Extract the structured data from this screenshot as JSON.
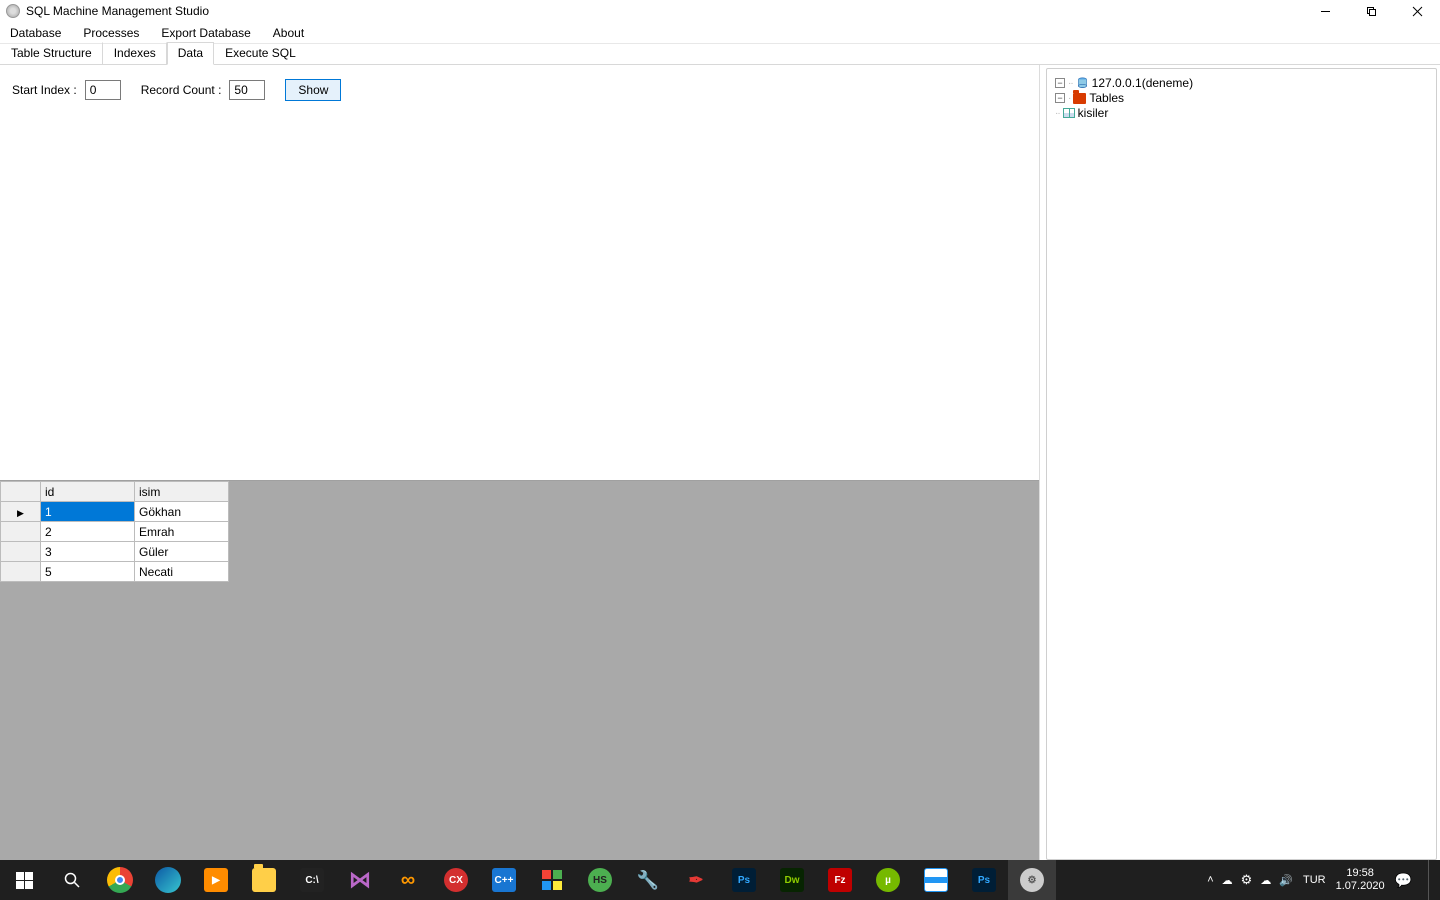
{
  "window": {
    "title": "SQL Machine Management Studio"
  },
  "menu": {
    "items": [
      "Database",
      "Processes",
      "Export Database",
      "About"
    ]
  },
  "tabs": {
    "items": [
      "Table Structure",
      "Indexes",
      "Data",
      "Execute SQL"
    ],
    "active_index": 2
  },
  "params": {
    "start_index_label": "Start Index :",
    "start_index_value": "0",
    "record_count_label": "Record Count :",
    "record_count_value": "50",
    "show_label": "Show"
  },
  "grid": {
    "columns": [
      "id",
      "isim"
    ],
    "rows": [
      {
        "id": "1",
        "isim": "Gökhan",
        "selected": true
      },
      {
        "id": "2",
        "isim": "Emrah"
      },
      {
        "id": "3",
        "isim": "Güler"
      },
      {
        "id": "5",
        "isim": "Necati"
      }
    ]
  },
  "tree": {
    "server_label": "127.0.0.1(deneme)",
    "tables_label": "Tables",
    "table_items": [
      "kisiler"
    ]
  },
  "system": {
    "language": "TUR",
    "time": "19:58",
    "date": "1.07.2020"
  }
}
